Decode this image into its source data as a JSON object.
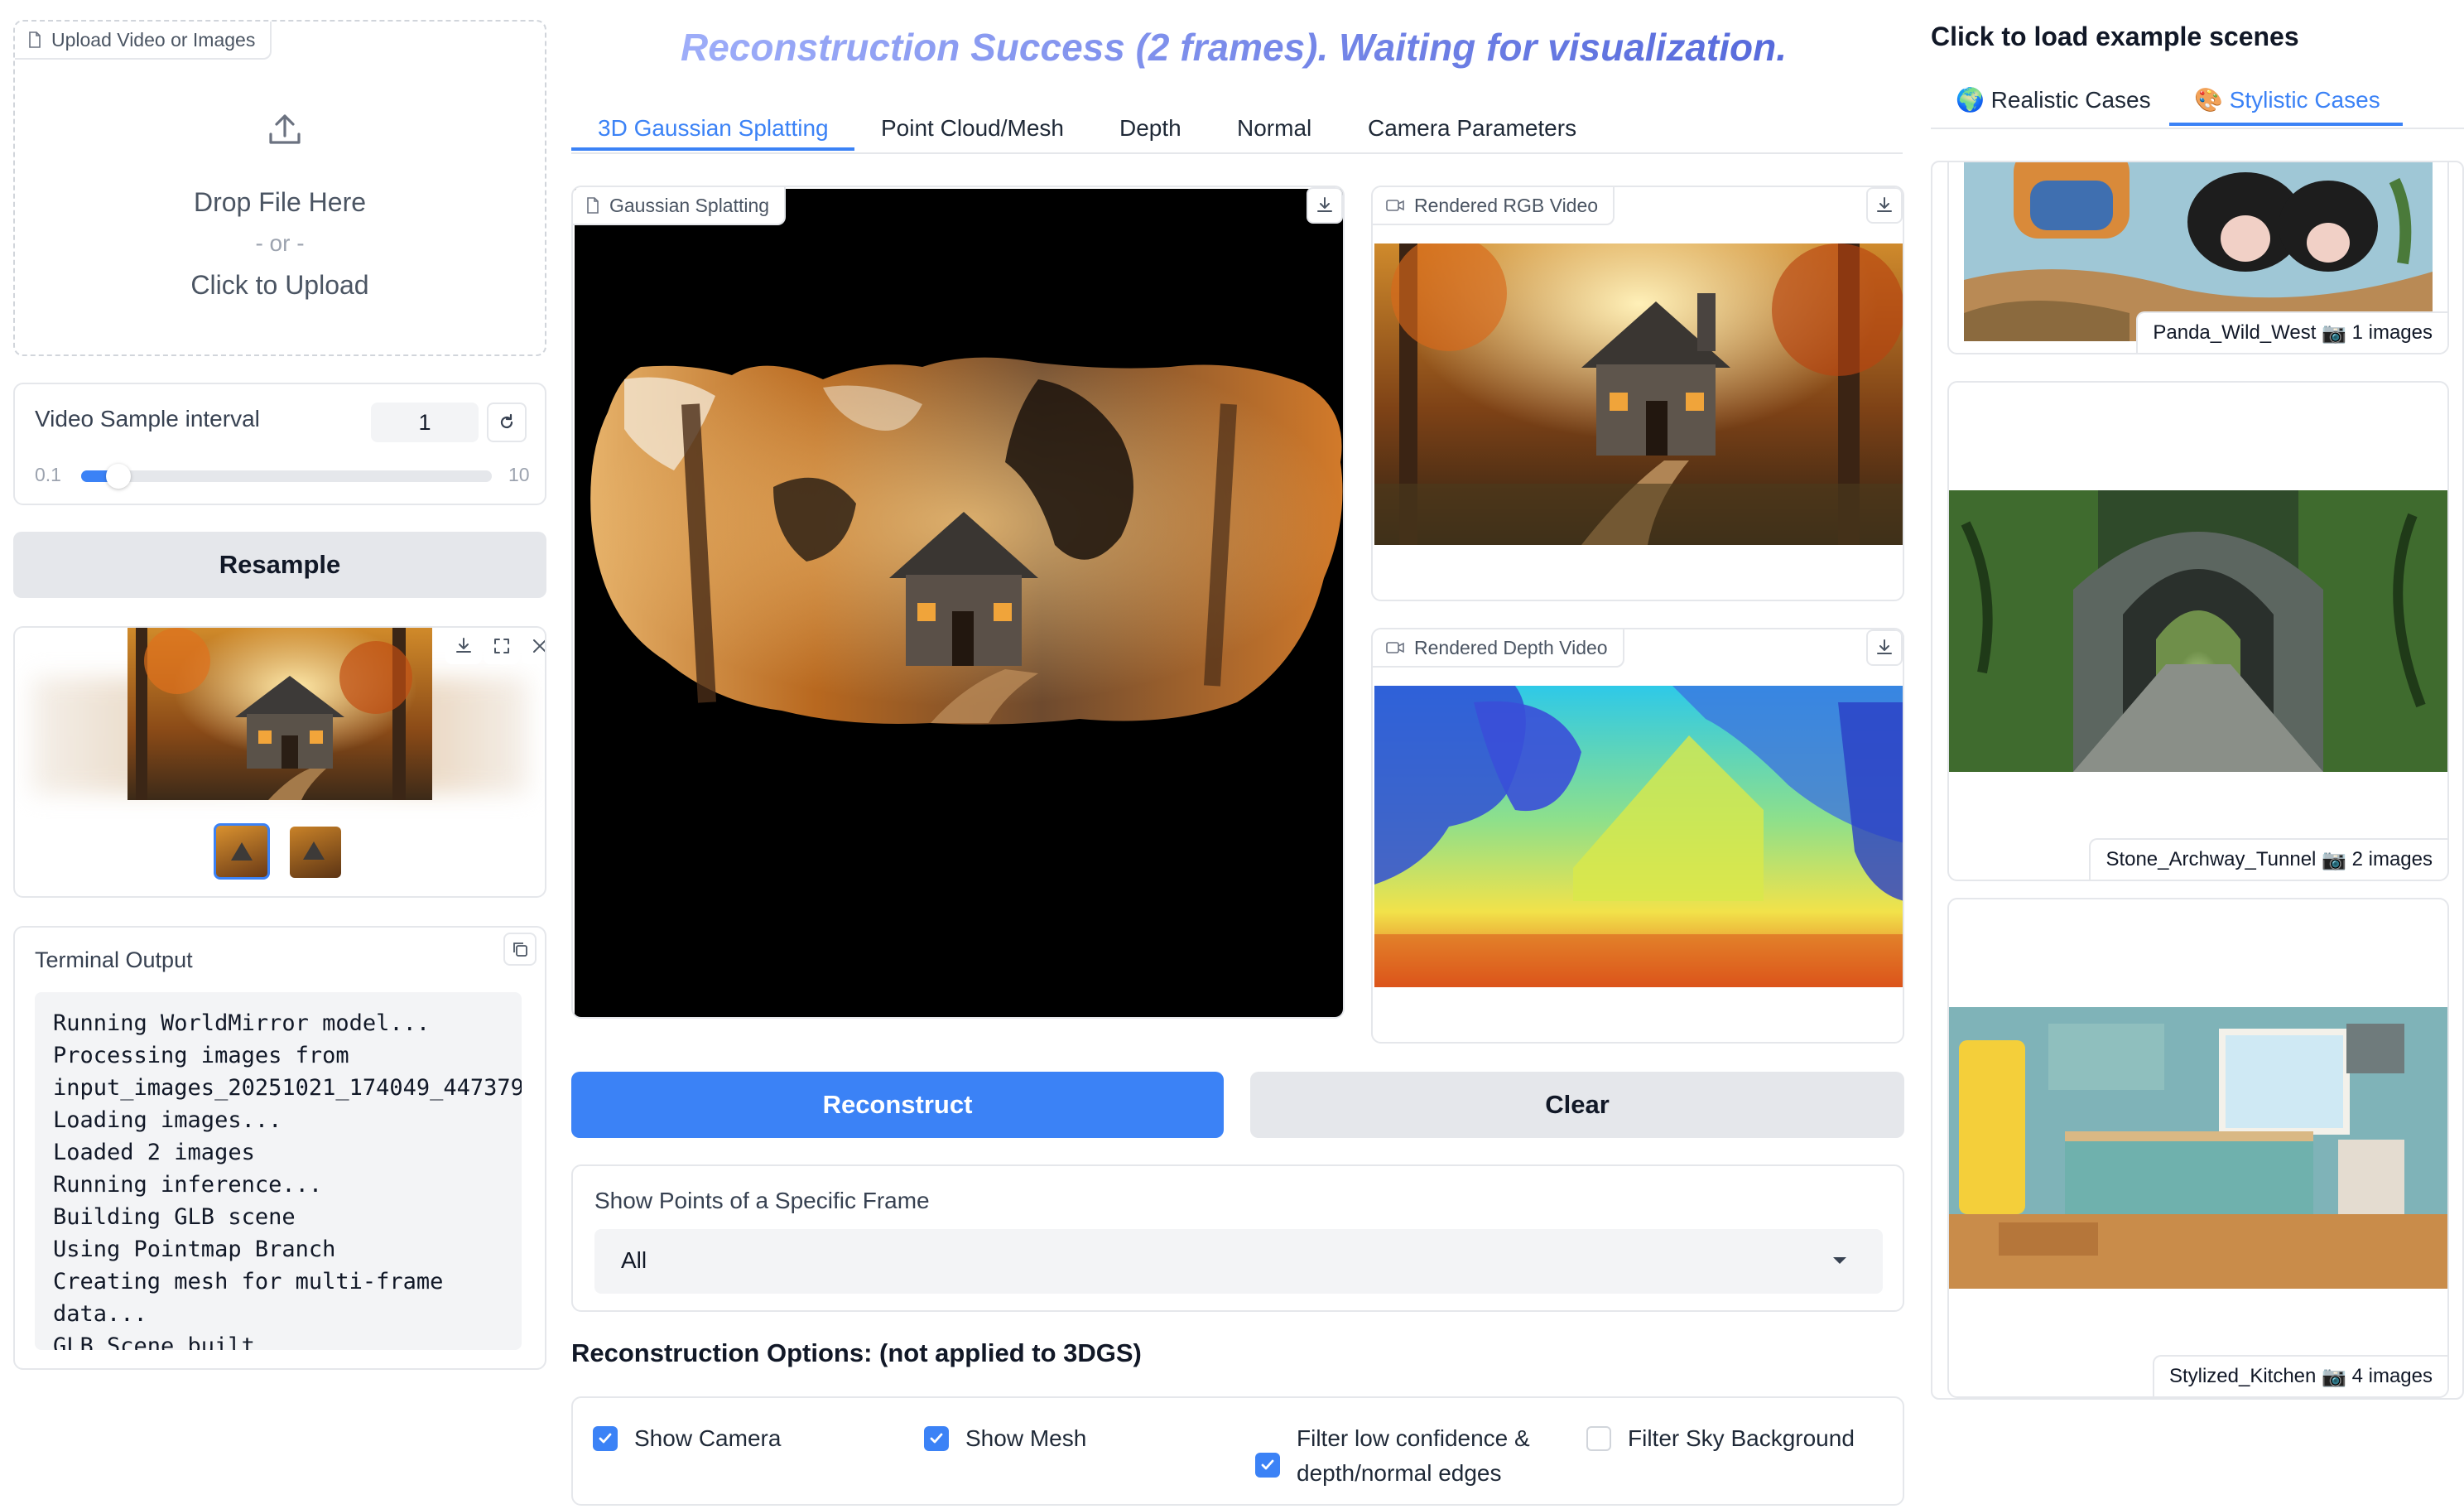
{
  "upload": {
    "tag_label": "Upload Video or Images",
    "drop_text": "Drop File Here",
    "or_text": "- or -",
    "click_text": "Click to Upload"
  },
  "sample_interval": {
    "label": "Video Sample interval",
    "value": "1",
    "min_label": "0.1",
    "max_label": "10",
    "slider_fraction": 0.09
  },
  "resample_button": "Resample",
  "terminal": {
    "label": "Terminal Output",
    "lines": [
      "Running WorldMirror model...",
      "Processing images from",
      "input_images_20251021_174049_447379",
      "Loading images...",
      "Loaded 2 images",
      "Running inference...",
      "Building GLB scene",
      "Using Pointmap Branch",
      "Creating mesh for multi-frame",
      "data...",
      "GLB Scene built"
    ]
  },
  "status_title": "Reconstruction Success (2 frames). Waiting for visualization.",
  "tabs": [
    {
      "label": "3D Gaussian Splatting",
      "active": true
    },
    {
      "label": "Point Cloud/Mesh",
      "active": false
    },
    {
      "label": "Depth",
      "active": false
    },
    {
      "label": "Normal",
      "active": false
    },
    {
      "label": "Camera Parameters",
      "active": false
    }
  ],
  "gaussian_panel_label": "Gaussian Splatting",
  "rgb_video_label": "Rendered RGB Video",
  "depth_video_label": "Rendered Depth Video",
  "reconstruct_button": "Reconstruct",
  "clear_button": "Clear",
  "frame_select": {
    "label": "Show Points of a Specific Frame",
    "value": "All"
  },
  "options": {
    "heading": "Reconstruction Options: (not applied to 3DGS)",
    "items": [
      {
        "label": "Show Camera",
        "checked": true
      },
      {
        "label": "Show Mesh",
        "checked": true
      },
      {
        "label": "Filter low confidence &",
        "label2": "depth/normal edges",
        "checked": true
      },
      {
        "label": "Filter Sky Background",
        "checked": false
      }
    ]
  },
  "examples": {
    "heading": "Click to load example scenes",
    "tabs": [
      {
        "label": "Realistic Cases",
        "icon": "🌍",
        "active": false
      },
      {
        "label": "Stylistic Cases",
        "icon": "🎨",
        "active": true
      }
    ],
    "scenes": [
      {
        "name": "Panda_Wild_West",
        "icon": "📷",
        "count": "1 images"
      },
      {
        "name": "Stone_Archway_Tunnel",
        "icon": "📷",
        "count": "2 images"
      },
      {
        "name": "Stylized_Kitchen",
        "icon": "📷",
        "count": "4 images"
      }
    ]
  },
  "colors": {
    "accent": "#3b82f6",
    "title_gradient_start": "#a5b4fc",
    "title_gradient_end": "#4f63d8"
  }
}
